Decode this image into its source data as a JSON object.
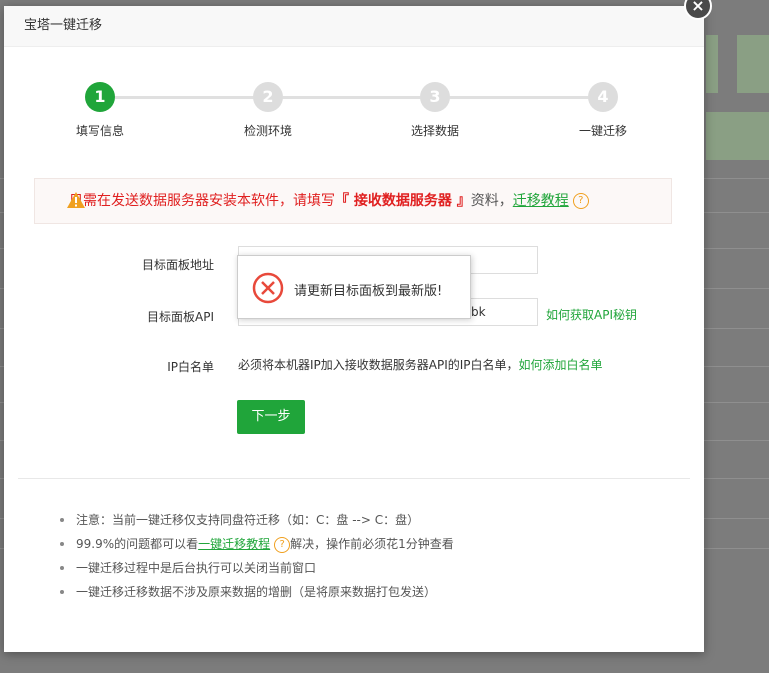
{
  "dialog": {
    "title": "宝塔一键迁移",
    "close_glyph": "×"
  },
  "steps": [
    {
      "number": "1",
      "label": "填写信息",
      "active": true
    },
    {
      "number": "2",
      "label": "检测环境",
      "active": false
    },
    {
      "number": "3",
      "label": "选择数据",
      "active": false
    },
    {
      "number": "4",
      "label": "一键迁移",
      "active": false
    }
  ],
  "warning": {
    "prefix": "只需在发送数据服务器安装本软件，请填写",
    "highlight": "『 接收数据服务器 』",
    "suffix": "资料，",
    "link": "迁移教程",
    "help_glyph": "?"
  },
  "form": {
    "panel_address_label": "目标面板地址",
    "panel_address_value": "",
    "panel_api_label": "目标面板API",
    "panel_api_value": "bk",
    "api_help_link": "如何获取API秘钥",
    "ip_whitelist_label": "IP白名单",
    "ip_whitelist_note": "必须将本机器IP加入接收数据服务器API的IP白名单，",
    "ip_whitelist_link": "如何添加白名单",
    "next_button": "下一步"
  },
  "toast": {
    "message": "请更新目标面板到最新版!",
    "icon": "error-circle-icon"
  },
  "notes": {
    "item1": "注意：当前一键迁移仅支持同盘符迁移（如：C：盘 --> C：盘）",
    "item2_prefix": "99.9%的问题都可以看",
    "item2_link": "一键迁移教程",
    "item2_suffix": "解决，操作前必须花1分钟查看",
    "item3": "一键迁移过程中是后台执行可以关闭当前窗口",
    "item4": "一键迁移迁移数据不涉及原来数据的增删（是将原来数据打包发送）"
  },
  "colors": {
    "accent": "#20a53a",
    "warning_text": "#e02020",
    "error_icon": "#e8493b"
  }
}
